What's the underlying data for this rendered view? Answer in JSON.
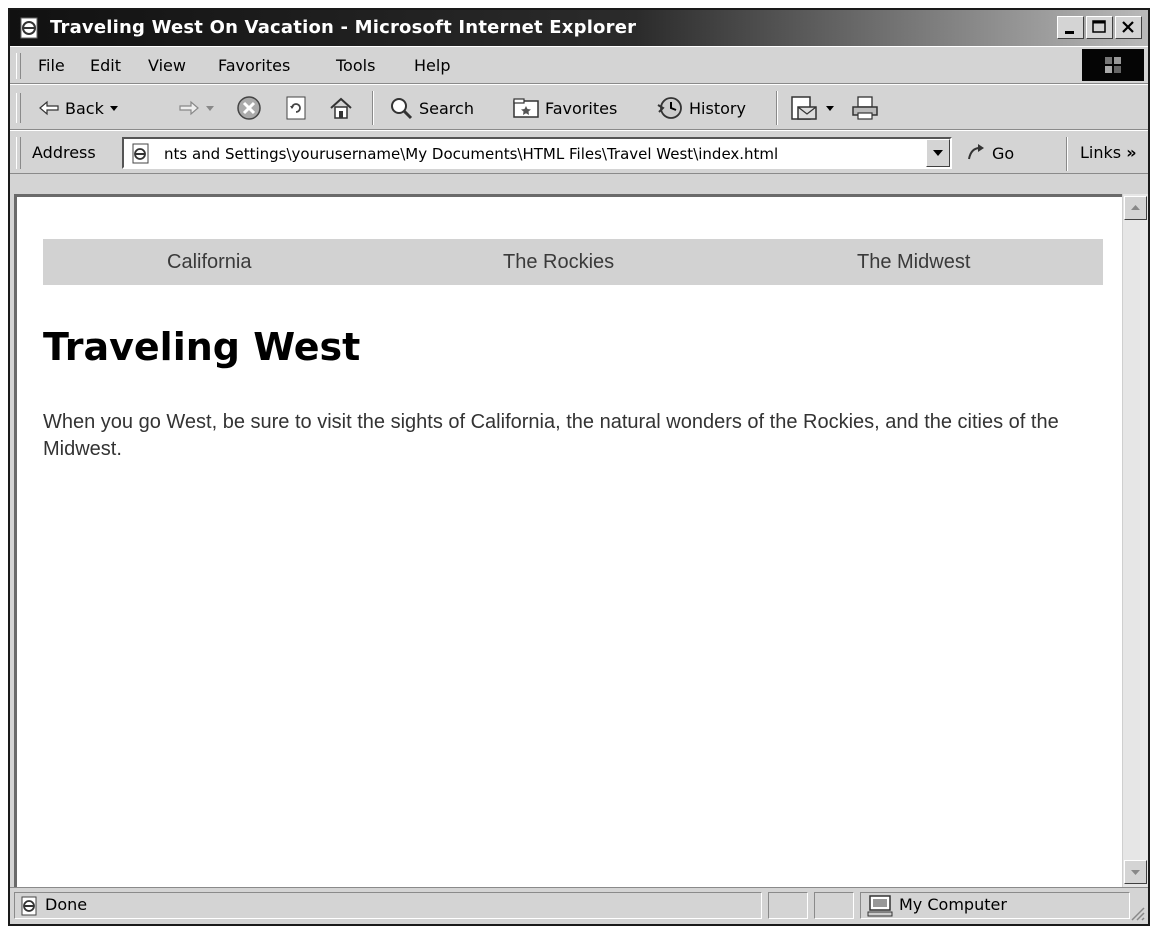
{
  "window": {
    "title": "Traveling West On Vacation - Microsoft Internet Explorer"
  },
  "menu": {
    "items": [
      "File",
      "Edit",
      "View",
      "Favorites",
      "Tools",
      "Help"
    ]
  },
  "toolbar": {
    "back_label": "Back",
    "search_label": "Search",
    "favorites_label": "Favorites",
    "history_label": "History"
  },
  "address": {
    "label": "Address",
    "value": "nts and Settings\\yourusername\\My Documents\\HTML Files\\Travel West\\index.html",
    "go_label": "Go",
    "links_label": "Links"
  },
  "page": {
    "nav": [
      "California",
      "The Rockies",
      "The Midwest"
    ],
    "heading": "Traveling West",
    "paragraph": "When you go West, be sure to visit the sights of California, the natural wonders of the Rockies, and the cities of the Midwest."
  },
  "status": {
    "text": "Done",
    "zone": "My Computer"
  },
  "icons": {
    "app": "ie-page-icon",
    "back": "back-arrow-icon",
    "forward": "forward-arrow-icon",
    "stop": "stop-icon",
    "refresh": "refresh-icon",
    "home": "home-icon",
    "search": "search-icon",
    "favorites": "favorites-icon",
    "history": "history-icon",
    "mail": "mail-icon",
    "print": "print-icon",
    "go": "go-arrow-icon",
    "computer": "computer-icon"
  }
}
